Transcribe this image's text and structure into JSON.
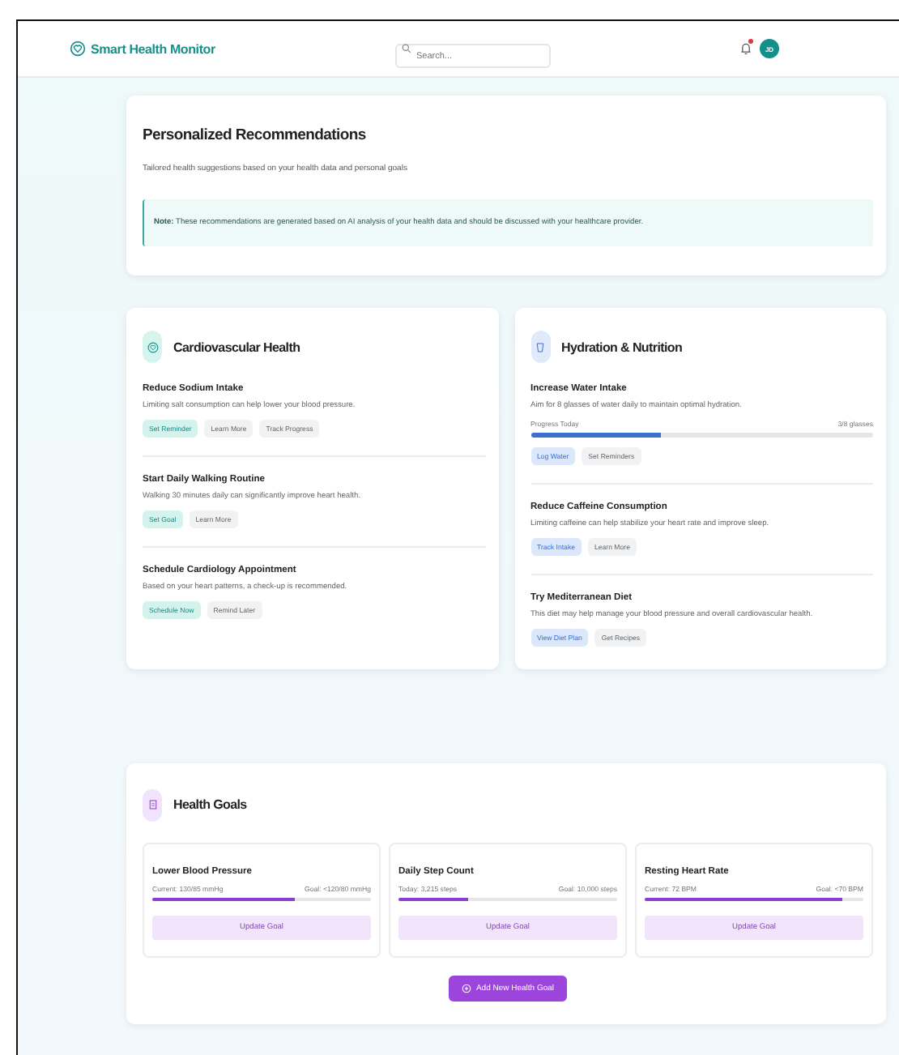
{
  "header": {
    "brand": "Smart Health Monitor",
    "search": {
      "placeholder": "Search..."
    },
    "notification": {
      "unread": true
    },
    "avatar": {
      "initials": "JD"
    }
  },
  "intro": {
    "title": "Personalized Recommendations",
    "subtitle": "Tailored health suggestions based on your health data and personal goals",
    "note": "**Note:** These recommendations are generated based on AI analysis of your health data and should be discussed with your healthcare provider."
  },
  "categories": [
    {
      "kind": "cardiovascular",
      "title": "Cardiovascular Health",
      "items": [
        {
          "title": "Reduce Sodium Intake",
          "text": "Limiting salt consumption can help lower your blood pressure.",
          "actions": [
            {
              "label": "Set Reminder",
              "kind": "primary"
            },
            {
              "label": "Learn More",
              "kind": "secondary"
            },
            {
              "label": "Track Progress",
              "kind": "secondary"
            }
          ]
        },
        {
          "title": "Start Daily Walking Routine",
          "text": "Walking 30 minutes daily can significantly improve heart health.",
          "actions": [
            {
              "label": "Set Goal",
              "kind": "primary"
            },
            {
              "label": "Learn More",
              "kind": "secondary"
            }
          ]
        },
        {
          "title": "Schedule Cardiology Appointment",
          "text": "Based on your heart patterns, a check-up is recommended.",
          "actions": [
            {
              "label": "Schedule Now",
              "kind": "primary"
            },
            {
              "label": "Remind Later",
              "kind": "secondary"
            }
          ]
        }
      ]
    },
    {
      "kind": "hydration",
      "title": "Hydration & Nutrition",
      "items": [
        {
          "title": "Increase Water Intake",
          "text": "Aim for 8 glasses of water daily to maintain optimal hydration.",
          "progress": {
            "label": "Progress Today",
            "reading": "3/8 glasses",
            "level": 0.38
          },
          "actions": [
            {
              "label": "Log Water",
              "kind": "primary"
            },
            {
              "label": "Set Reminders",
              "kind": "secondary"
            }
          ]
        },
        {
          "title": "Reduce Caffeine Consumption",
          "text": "Limiting caffeine can help stabilize your heart rate and improve sleep.",
          "actions": [
            {
              "label": "Track Intake",
              "kind": "primary"
            },
            {
              "label": "Learn More",
              "kind": "secondary"
            }
          ]
        },
        {
          "title": "Try Mediterranean Diet",
          "text": "This diet may help manage your blood pressure and overall cardiovascular health.",
          "actions": [
            {
              "label": "View Diet Plan",
              "kind": "primary"
            },
            {
              "label": "Get Recipes",
              "kind": "secondary"
            }
          ]
        }
      ]
    }
  ],
  "goals": {
    "title": "Health Goals",
    "items": [
      {
        "title": "Lower Blood Pressure",
        "current": "Current: 130/85 mmHg",
        "target": "Goal: <120/80 mmHg",
        "level": 0.65,
        "button": "Update Goal"
      },
      {
        "title": "Daily Step Count",
        "current": "Today: 3,215 steps",
        "target": "Goal: 10,000 steps",
        "level": 0.32,
        "button": "Update Goal"
      },
      {
        "title": "Resting Heart Rate",
        "current": "Current: 72 BPM",
        "target": "Goal: <70 BPM",
        "level": 0.9,
        "button": "Update Goal"
      }
    ],
    "add_button": "Add New Health Goal"
  }
}
